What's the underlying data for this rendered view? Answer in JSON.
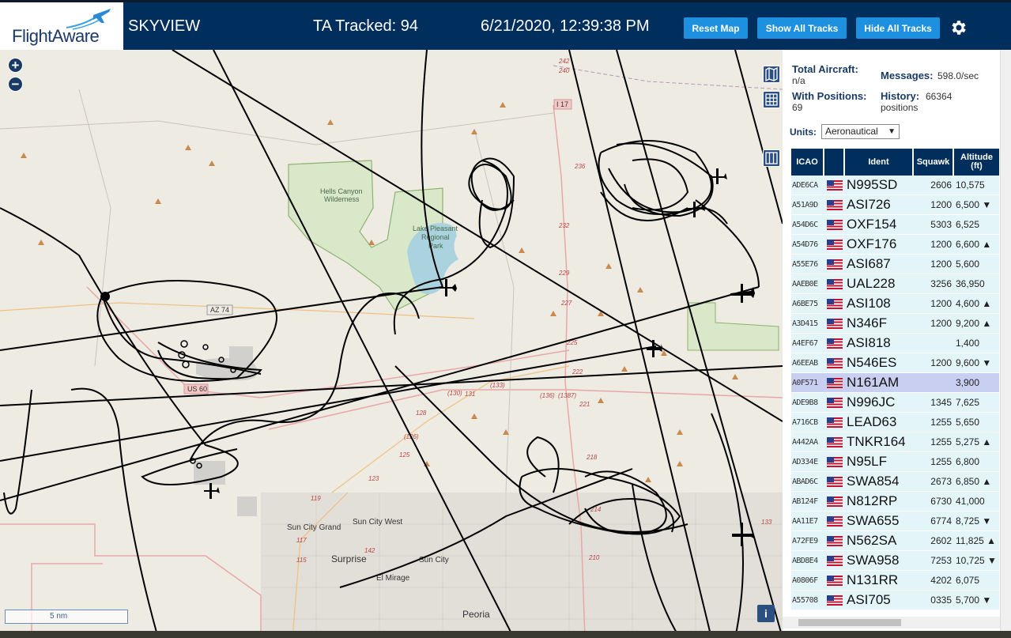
{
  "header": {
    "logo_text": "FlightAware",
    "app_title": "SKYVIEW",
    "ta_tracked": "TA Tracked: 94",
    "clock": "6/21/2020, 12:39:38 PM",
    "buttons": {
      "reset": "Reset Map",
      "show_all": "Show All Tracks",
      "hide_all": "Hide All Tracks"
    },
    "accent": "#1e90e0",
    "bg": "#002f5d"
  },
  "map": {
    "zoom_in": "+",
    "zoom_out": "−",
    "scale": "5 nm",
    "info": "i",
    "labels": {
      "hells_canyon": "Hells Canyon",
      "wilderness": "Wilderness",
      "lake_pleasant_1": "Lake Pleasant",
      "lake_pleasant_2": "Regional",
      "lake_pleasant_3": "Park",
      "az74": "AZ 74",
      "us60": "US 60",
      "i17": "I 17",
      "sun_city_grand": "Sun City Grand",
      "sun_city_west": "Sun City West",
      "surprise": "Surprise",
      "sun_city": "Sun City",
      "el_mirage": "El Mirage",
      "peoria": "Peoria",
      "r242": "242",
      "r240": "240",
      "r236": "236",
      "r232": "232",
      "r229": "229",
      "r227": "227",
      "r225": "225",
      "r222": "222",
      "r221": "221",
      "r218": "218",
      "r214": "214",
      "r210": "210",
      "r131": "131",
      "r133": "(133)",
      "r136": "(136)",
      "r1387": "(1387)",
      "r130": "(130)",
      "r128": "128",
      "r126": "(126)",
      "r125": "125",
      "r123": "123",
      "r119": "119",
      "r117": "117",
      "r115": "115",
      "r142": "142",
      "r133b": "133"
    }
  },
  "sidebar": {
    "total_aircraft_label": "Total Aircraft:",
    "total_aircraft_value": "n/a",
    "with_positions_label": "With Positions:",
    "with_positions_value": "69",
    "messages_label": "Messages:",
    "messages_value": "598.0/sec",
    "history_label": "History:",
    "history_value": "66364",
    "history_unit": "positions",
    "units_label": "Units:",
    "units_value": "Aeronautical",
    "columns": {
      "icao": "ICAO",
      "ident": "Ident",
      "squawk": "Squawk",
      "alt_1": "Altitude",
      "alt_2": "(ft)"
    },
    "rows": [
      {
        "icao": "ADE6CA",
        "ident": "N995SD",
        "squawk": "2606",
        "alt": "10,575",
        "trend": ""
      },
      {
        "icao": "A51A9D",
        "ident": "ASI726",
        "squawk": "1200",
        "alt": "6,500",
        "trend": "▼"
      },
      {
        "icao": "A54D6C",
        "ident": "OXF154",
        "squawk": "5303",
        "alt": "6,525",
        "trend": ""
      },
      {
        "icao": "A54D76",
        "ident": "OXF176",
        "squawk": "1200",
        "alt": "6,600",
        "trend": "▲"
      },
      {
        "icao": "A55E76",
        "ident": "ASI687",
        "squawk": "1200",
        "alt": "5,600",
        "trend": ""
      },
      {
        "icao": "AAEB0E",
        "ident": "UAL228",
        "squawk": "3256",
        "alt": "36,950",
        "trend": ""
      },
      {
        "icao": "A6BE75",
        "ident": "ASI108",
        "squawk": "1200",
        "alt": "4,600",
        "trend": "▲"
      },
      {
        "icao": "A3D415",
        "ident": "N346F",
        "squawk": "1200",
        "alt": "9,200",
        "trend": "▲"
      },
      {
        "icao": "A4EF67",
        "ident": "ASI818",
        "squawk": "",
        "alt": "1,400",
        "trend": ""
      },
      {
        "icao": "A6EEAB",
        "ident": "N546ES",
        "squawk": "1200",
        "alt": "9,600",
        "trend": "▼"
      },
      {
        "icao": "A0F571",
        "ident": "N161AM",
        "squawk": "",
        "alt": "3,900",
        "trend": "",
        "selected": true
      },
      {
        "icao": "ADE9B8",
        "ident": "N996JC",
        "squawk": "1345",
        "alt": "7,625",
        "trend": ""
      },
      {
        "icao": "A716CB",
        "ident": "LEAD63",
        "squawk": "1255",
        "alt": "5,650",
        "trend": ""
      },
      {
        "icao": "A442AA",
        "ident": "TNKR164",
        "squawk": "1255",
        "alt": "5,275",
        "trend": "▲"
      },
      {
        "icao": "AD334E",
        "ident": "N95LF",
        "squawk": "1255",
        "alt": "6,800",
        "trend": ""
      },
      {
        "icao": "ABAD6C",
        "ident": "SWA854",
        "squawk": "2673",
        "alt": "6,850",
        "trend": "▲"
      },
      {
        "icao": "AB124F",
        "ident": "N812RP",
        "squawk": "6730",
        "alt": "41,000",
        "trend": ""
      },
      {
        "icao": "AA11E7",
        "ident": "SWA655",
        "squawk": "6774",
        "alt": "8,725",
        "trend": "▼"
      },
      {
        "icao": "A72FE9",
        "ident": "N562SA",
        "squawk": "2602",
        "alt": "11,825",
        "trend": "▲"
      },
      {
        "icao": "ABD8E4",
        "ident": "SWA958",
        "squawk": "7253",
        "alt": "10,725",
        "trend": "▼"
      },
      {
        "icao": "A0806F",
        "ident": "N131RR",
        "squawk": "4202",
        "alt": "6,075",
        "trend": ""
      },
      {
        "icao": "A55708",
        "ident": "ASI705",
        "squawk": "0335",
        "alt": "5,700",
        "trend": "▼"
      }
    ]
  }
}
